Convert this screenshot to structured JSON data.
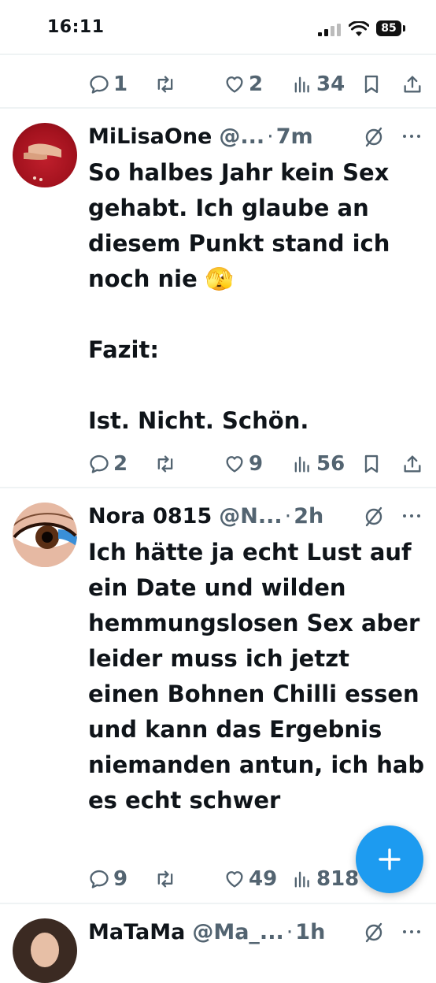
{
  "status_bar": {
    "time": "16:11",
    "battery": "85"
  },
  "tweets": [
    {
      "partial": true,
      "replies": "1",
      "likes": "2",
      "views": "34"
    },
    {
      "name": "MiLisaOne",
      "handle": "@...",
      "dot": "·",
      "age": "7m",
      "text": "So halbes Jahr kein Sex gehabt. Ich glaube an diesem Punkt stand ich noch nie 🫣\n\nFazit:\n\nIst. Nicht. Schön.",
      "replies": "2",
      "likes": "9",
      "views": "56"
    },
    {
      "name": "Nora 0815",
      "handle": "@N...",
      "dot": "·",
      "age": "2h",
      "text": "Ich hätte ja echt Lust auf ein Date und wilden hemmungslosen Sex aber leider muss ich jetzt einen Bohnen Chilli essen und kann das Ergebnis niemanden antun, ich hab es echt schwer",
      "replies": "9",
      "likes": "49",
      "views": "818"
    },
    {
      "name": "MaTaMa",
      "handle": "@Ma_...",
      "dot": "·",
      "age": "1h"
    }
  ],
  "icons": {
    "reply": "speech-bubble-icon",
    "retweet": "retweet-arrows-icon",
    "like": "heart-icon",
    "views": "bar-chart-icon",
    "bookmark": "bookmark-icon",
    "share": "share-upload-icon",
    "grok": "grok-slash-circle-icon",
    "more": "more-dots-icon",
    "compose": "plus-icon"
  },
  "colors": {
    "accent": "#1d9bf0",
    "secondary_text": "#536471",
    "primary_text": "#0f1419"
  }
}
